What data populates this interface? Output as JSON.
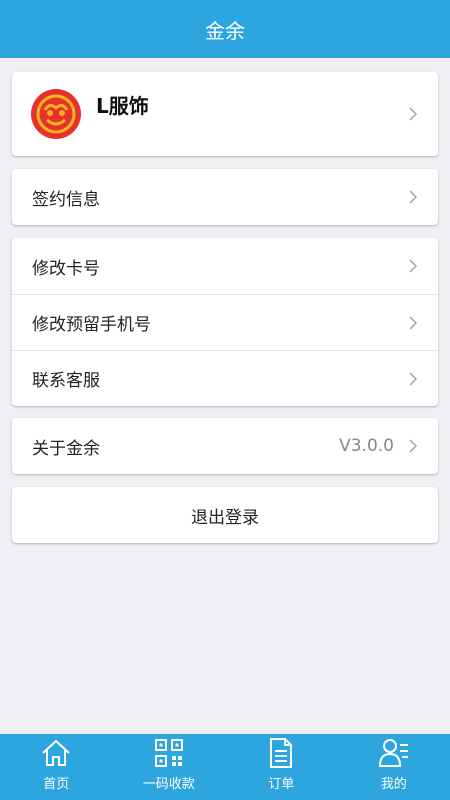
{
  "header": {
    "title": "金余"
  },
  "profile": {
    "name": "L服饰"
  },
  "menu": {
    "contract_info": "签约信息",
    "change_card": "修改卡号",
    "change_phone": "修改预留手机号",
    "contact_service": "联系客服",
    "about": "关于金余",
    "version": "V3.0.0",
    "logout": "退出登录"
  },
  "tabs": [
    {
      "label": "首页",
      "icon": "home-icon"
    },
    {
      "label": "一码收款",
      "icon": "qr-code-icon"
    },
    {
      "label": "订单",
      "icon": "document-icon"
    },
    {
      "label": "我的",
      "icon": "user-icon"
    }
  ],
  "colors": {
    "accent": "#2da6e0",
    "background": "#efeff4",
    "logo_red": "#e8312f",
    "logo_gold": "#f3b51a"
  }
}
